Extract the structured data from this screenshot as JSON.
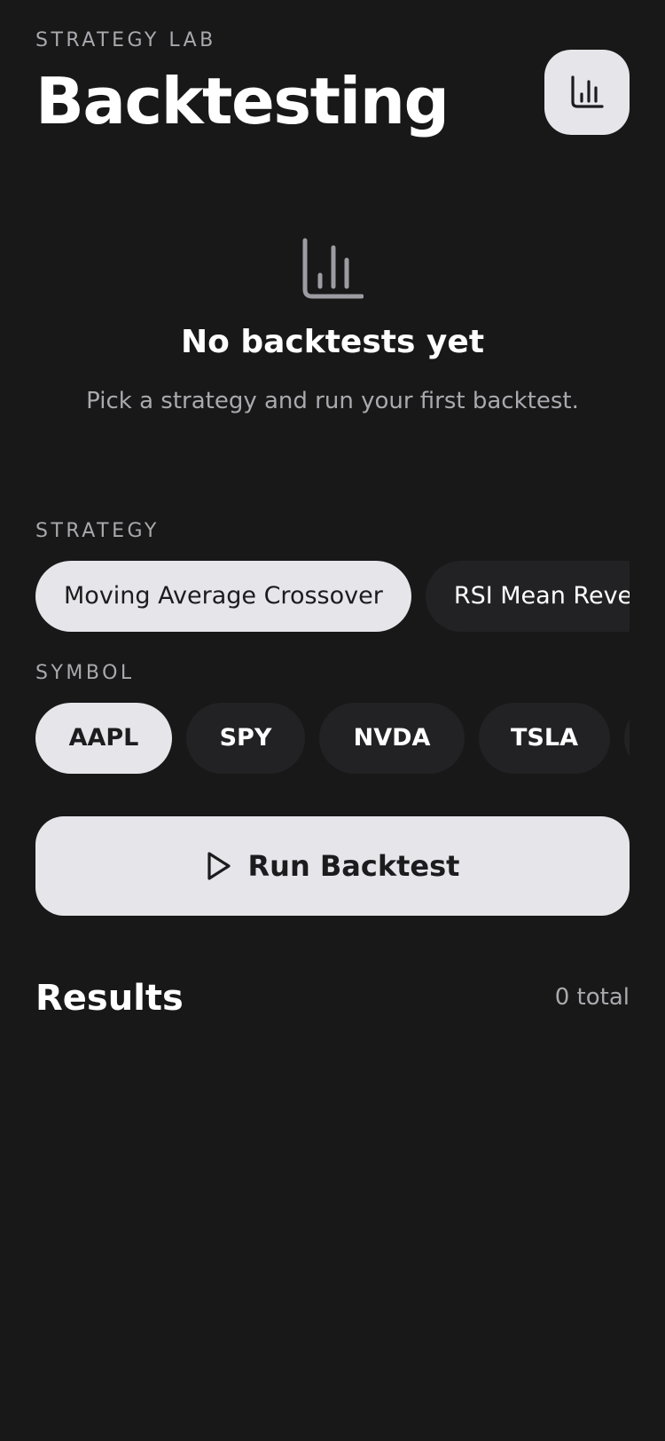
{
  "header": {
    "eyebrow": "STRATEGY LAB",
    "title": "Backtesting",
    "chart_button_icon": "bar-chart-icon"
  },
  "empty_state": {
    "icon": "bar-chart-icon",
    "title": "No backtests yet",
    "subtitle": "Pick a strategy and run your first backtest."
  },
  "strategy": {
    "label": "STRATEGY",
    "options": [
      {
        "label": "Moving Average Crossover",
        "selected": true
      },
      {
        "label": "RSI Mean Reversion",
        "selected": false
      }
    ]
  },
  "symbol": {
    "label": "SYMBOL",
    "options": [
      {
        "label": "AAPL",
        "selected": true
      },
      {
        "label": "SPY",
        "selected": false
      },
      {
        "label": "NVDA",
        "selected": false
      },
      {
        "label": "TSLA",
        "selected": false
      }
    ]
  },
  "run_button": {
    "label": "Run Backtest",
    "icon": "play-icon"
  },
  "results": {
    "title": "Results",
    "count": "0 total"
  },
  "colors": {
    "background": "#181818",
    "chip_selected": "#e5e5ea",
    "chip_unselected": "#222224",
    "muted_text": "#a9a9ae",
    "dark_text": "#1c1c1e"
  }
}
